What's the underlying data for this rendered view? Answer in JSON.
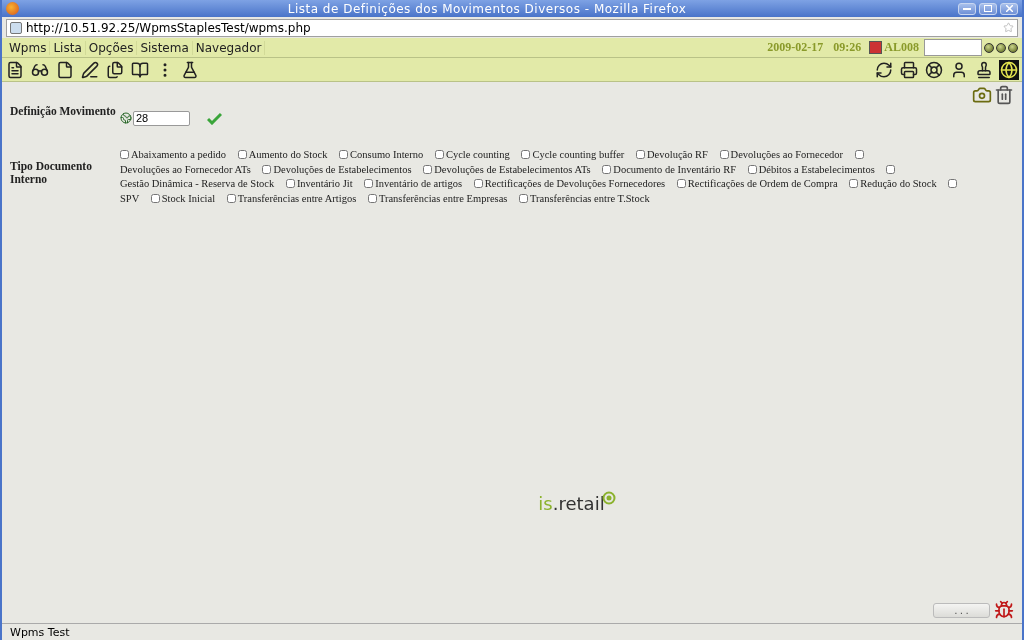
{
  "window": {
    "title": "Lista de Definições dos Movimentos Diversos - Mozilla Firefox"
  },
  "address_bar": {
    "value": "http://10.51.92.25/WpmsStaplesTest/wpms.php"
  },
  "menu": [
    "Wpms",
    "Lista",
    "Opções",
    "Sistema",
    "Navegador"
  ],
  "header": {
    "date": "2009-02-17",
    "time": "09:26",
    "user": "AL008"
  },
  "form": {
    "definition_label": "Definição Movimento",
    "definition_value": "28",
    "type_label": "Tipo Documento Interno",
    "types": [
      {
        "label": "Abaixamento a pedido",
        "checked": false
      },
      {
        "label": "Aumento do Stock",
        "checked": false
      },
      {
        "label": "Consumo Interno",
        "checked": false
      },
      {
        "label": "Cycle counting",
        "checked": false
      },
      {
        "label": "Cycle counting buffer",
        "checked": false
      },
      {
        "label": "Devolução RF",
        "checked": false
      },
      {
        "label": "Devoluções ao Fornecedor",
        "checked": false
      },
      {
        "label": "Devoluções ao Fornecedor ATs",
        "checked": false
      },
      {
        "label": "Devoluções de Estabelecimentos",
        "checked": false
      },
      {
        "label": "Devoluções de Estabelecimentos ATs",
        "checked": false
      },
      {
        "label": "Documento de Inventário RF",
        "checked": false
      },
      {
        "label": "Débitos a Estabelecimentos",
        "checked": false
      },
      {
        "label": "Gestão Dinâmica - Reserva de Stock",
        "checked": false
      },
      {
        "label": "Inventário Jit",
        "checked": false
      },
      {
        "label": "Inventário de artigos",
        "checked": false
      },
      {
        "label": "Rectificações de Devoluções Fornecedores",
        "checked": false
      },
      {
        "label": "Rectificações de Ordem de Compra",
        "checked": false
      },
      {
        "label": "Redução do Stock",
        "checked": false
      },
      {
        "label": "SPV",
        "checked": false
      },
      {
        "label": "Stock Inicial",
        "checked": false
      },
      {
        "label": "Transferências entre Artigos",
        "checked": false
      },
      {
        "label": "Transferências entre Empresas",
        "checked": false
      },
      {
        "label": "Transferências entre T.Stock",
        "checked": false
      }
    ]
  },
  "logo": {
    "prefix": "is",
    "rest": ".retail"
  },
  "more_button": ". . .",
  "status_bar": "Wpms Test"
}
